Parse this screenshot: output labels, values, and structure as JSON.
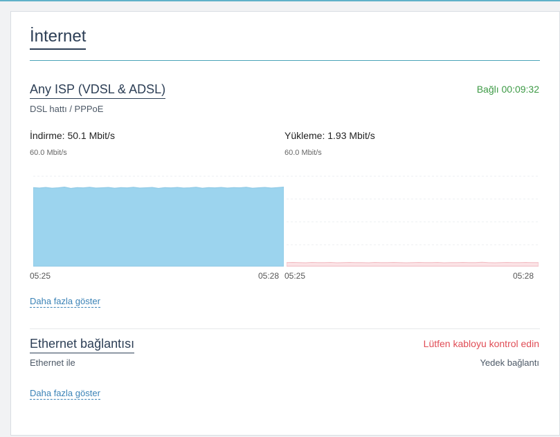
{
  "colors": {
    "accent_line": "#4aa3b8",
    "title": "#2c3e55",
    "connected": "#3d9a45",
    "warning": "#e04c55",
    "link": "#3a82b6",
    "download_fill": "#9cd4ee",
    "upload_fill": "#fbe3e6"
  },
  "page": {
    "title": "İnternet"
  },
  "isp": {
    "name": "Any ISP (VDSL & ADSL)",
    "status": "Bağlı 00:09:32",
    "line_type": "DSL hattı / PPPoE",
    "download": {
      "label": "İndirme: 50.1 Mbit/s",
      "axis_max": "60.0 Mbit/s",
      "time_start": "05:25",
      "time_end": "05:28"
    },
    "upload": {
      "label": "Yükleme: 1.93 Mbit/s",
      "axis_max": "60.0 Mbit/s",
      "time_start": "05:25",
      "time_end": "05:28"
    },
    "more_link": "Daha fazla göster"
  },
  "ethernet": {
    "title": "Ethernet bağlantısı",
    "status": "Lütfen kabloyu kontrol edin",
    "mode": "Ethernet ile",
    "role": "Yedek bağlantı",
    "more_link": "Daha fazla göster"
  },
  "chart_data": [
    {
      "type": "area",
      "name": "İndirme",
      "ylim": [
        0,
        60
      ],
      "unit": "Mbit/s",
      "x": [
        "05:25",
        "05:28"
      ],
      "values": [
        50.5,
        50.2,
        50.6,
        50.1,
        50.4,
        50.8,
        50.0,
        50.5,
        50.3,
        50.7,
        50.2,
        50.4,
        50.6,
        50.1,
        50.5,
        50.3,
        50.7,
        50.2,
        50.4,
        50.6,
        50.0,
        50.5,
        50.3,
        50.6,
        50.2,
        50.4,
        50.7,
        50.1,
        50.5,
        50.3,
        50.6,
        50.2,
        50.5,
        50.4,
        50.7,
        50.1,
        50.4,
        50.6,
        50.2,
        50.5,
        50.8
      ]
    },
    {
      "type": "area",
      "name": "Yükleme",
      "ylim": [
        0,
        60
      ],
      "unit": "Mbit/s",
      "x": [
        "05:25",
        "05:28"
      ],
      "values": [
        1.9,
        2.0,
        1.9,
        1.8,
        2.0,
        1.9,
        1.9,
        2.0,
        1.8,
        1.9,
        2.0,
        1.9,
        1.9,
        1.8,
        2.0,
        1.9,
        1.9,
        2.0,
        1.9,
        1.8,
        1.9,
        2.0,
        1.9,
        1.9,
        2.0,
        1.8,
        1.9,
        1.9,
        2.0,
        1.9,
        1.9,
        2.1,
        1.9,
        1.8,
        1.9,
        2.0,
        1.9,
        1.9,
        2.0,
        1.9,
        1.9
      ]
    }
  ]
}
